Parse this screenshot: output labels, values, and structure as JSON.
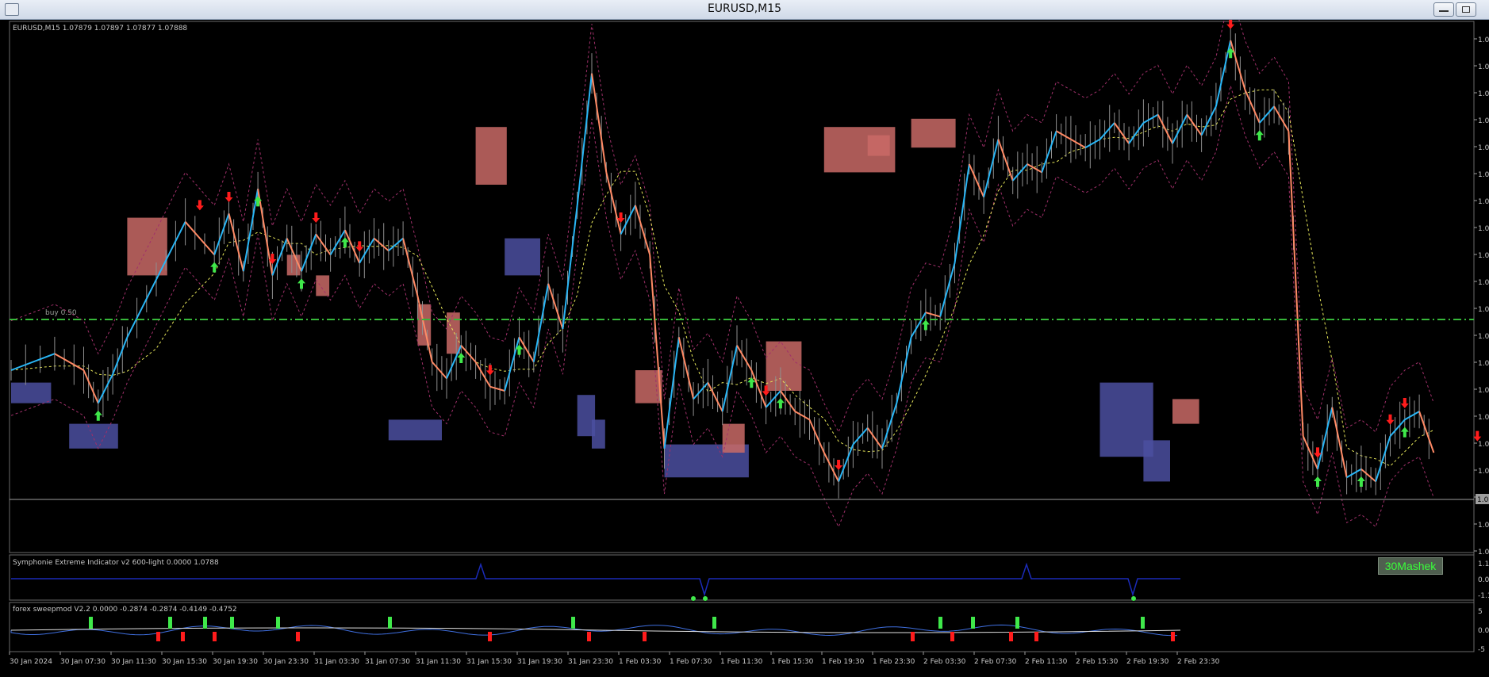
{
  "window": {
    "title": "EURUSD,M15",
    "sys_icon": "app-window-icon",
    "buttons": [
      "minimize-icon",
      "maximize-icon"
    ]
  },
  "main_pane": {
    "header": "EURUSD,M15  1.07879 1.07897 1.07877 1.07888",
    "level_label": "buy 0.50",
    "price_ticks": [
      "1.0",
      "1.0",
      "1.0",
      "1.0",
      "1.0",
      "1.0",
      "1.0",
      "1.0",
      "1.0",
      "1.0",
      "1.0",
      "1.0",
      "1.0",
      "1.0",
      "1.0",
      "1.0",
      "1.0",
      "1.0",
      "1.0",
      "1.0"
    ],
    "current_price_tag": "1.0",
    "badge": "30Mashek"
  },
  "indicator1": {
    "label": "Symphonie Extreme Indicator v2 600-light 0.0000 1.0788",
    "ticks": [
      "1.1",
      "0.0",
      "-1.1"
    ]
  },
  "indicator2": {
    "label": "forex sweepmod V2.2 0.0000 -0.2874 -0.2874 -0.4149 -0.4752",
    "ticks": [
      "5",
      "0.0",
      "-5"
    ]
  },
  "time_axis": [
    "30 Jan 2024",
    "30 Jan 07:30",
    "30 Jan 11:30",
    "30 Jan 15:30",
    "30 Jan 19:30",
    "30 Jan 23:30",
    "31 Jan 03:30",
    "31 Jan 07:30",
    "31 Jan 11:30",
    "31 Jan 15:30",
    "31 Jan 19:30",
    "31 Jan 23:30",
    "1 Feb 03:30",
    "1 Feb 07:30",
    "1 Feb 11:30",
    "1 Feb 15:30",
    "1 Feb 19:30",
    "1 Feb 23:30",
    "2 Feb 03:30",
    "2 Feb 07:30",
    "2 Feb 11:30",
    "2 Feb 15:30",
    "2 Feb 19:30",
    "2 Feb 23:30"
  ],
  "colors": {
    "up": "#29b6f6",
    "down": "#ff8a65",
    "supply": "#c96a66",
    "demand": "#4b4fa0",
    "grid_line": "#9e9e9e",
    "level": "#37b83a",
    "buy_arrow": "#3fe84a",
    "sell_arrow": "#ff1c1c",
    "band": "#a0306a",
    "ma": "#e8e85a",
    "osc": "#1b2bb8"
  },
  "chart_data": {
    "type": "line",
    "price_path": [
      [
        0,
        4
      ],
      [
        3,
        4.4
      ],
      [
        5,
        4
      ],
      [
        6,
        3.2
      ],
      [
        7,
        3.9
      ],
      [
        8,
        4.8
      ],
      [
        10,
        6.2
      ],
      [
        12,
        7.6
      ],
      [
        14,
        6.8
      ],
      [
        15,
        7.8
      ],
      [
        16,
        6.4
      ],
      [
        17,
        8.4
      ],
      [
        18,
        6.3
      ],
      [
        19,
        7.2
      ],
      [
        20,
        6.4
      ],
      [
        21,
        7.3
      ],
      [
        22,
        6.8
      ],
      [
        23,
        7.4
      ],
      [
        24,
        6.6
      ],
      [
        25,
        7.2
      ],
      [
        26,
        6.9
      ],
      [
        27,
        7.2
      ],
      [
        28,
        5.8
      ],
      [
        29,
        4.2
      ],
      [
        30,
        3.8
      ],
      [
        31,
        4.6
      ],
      [
        32,
        4.2
      ],
      [
        33,
        3.6
      ],
      [
        34,
        3.5
      ],
      [
        35,
        4.8
      ],
      [
        36,
        4.2
      ],
      [
        37,
        6.1
      ],
      [
        38,
        5.0
      ],
      [
        39,
        8.0
      ],
      [
        40,
        11.2
      ],
      [
        41,
        8.8
      ],
      [
        42,
        7.3
      ],
      [
        43,
        8.0
      ],
      [
        44,
        6.8
      ],
      [
        45,
        2.1
      ],
      [
        46,
        4.8
      ],
      [
        47,
        3.3
      ],
      [
        48,
        3.7
      ],
      [
        49,
        3.0
      ],
      [
        50,
        4.6
      ],
      [
        51,
        4.0
      ],
      [
        52,
        3.1
      ],
      [
        53,
        3.5
      ],
      [
        54,
        3.0
      ],
      [
        55,
        2.8
      ],
      [
        56,
        2.0
      ],
      [
        57,
        1.3
      ],
      [
        58,
        2.2
      ],
      [
        59,
        2.6
      ],
      [
        60,
        2.1
      ],
      [
        61,
        3.2
      ],
      [
        62,
        4.8
      ],
      [
        63,
        5.4
      ],
      [
        64,
        5.3
      ],
      [
        65,
        6.6
      ],
      [
        66,
        9.0
      ],
      [
        67,
        8.2
      ],
      [
        68,
        9.6
      ],
      [
        69,
        8.6
      ],
      [
        70,
        9.0
      ],
      [
        71,
        8.8
      ],
      [
        72,
        9.8
      ],
      [
        73,
        9.6
      ],
      [
        74,
        9.4
      ],
      [
        75,
        9.6
      ],
      [
        76,
        10.0
      ],
      [
        77,
        9.5
      ],
      [
        78,
        10.0
      ],
      [
        79,
        10.2
      ],
      [
        80,
        9.5
      ],
      [
        81,
        10.2
      ],
      [
        82,
        9.7
      ],
      [
        83,
        10.4
      ],
      [
        84,
        12.0
      ],
      [
        85,
        10.8
      ],
      [
        86,
        10.0
      ],
      [
        87,
        10.4
      ],
      [
        88,
        9.8
      ],
      [
        89,
        2.4
      ],
      [
        90,
        1.6
      ],
      [
        91,
        3.1
      ],
      [
        92,
        1.4
      ],
      [
        93,
        1.6
      ],
      [
        94,
        1.3
      ],
      [
        95,
        2.4
      ],
      [
        96,
        2.8
      ],
      [
        97,
        3.0
      ],
      [
        98,
        2.0
      ]
    ],
    "markers_buy": [
      6,
      14,
      17,
      20,
      23,
      31,
      35,
      51,
      53,
      63,
      84,
      86,
      90,
      93,
      96
    ],
    "markers_sell": [
      13,
      15,
      18,
      21,
      24,
      33,
      42,
      52,
      57,
      84,
      90,
      95,
      96,
      101
    ]
  }
}
